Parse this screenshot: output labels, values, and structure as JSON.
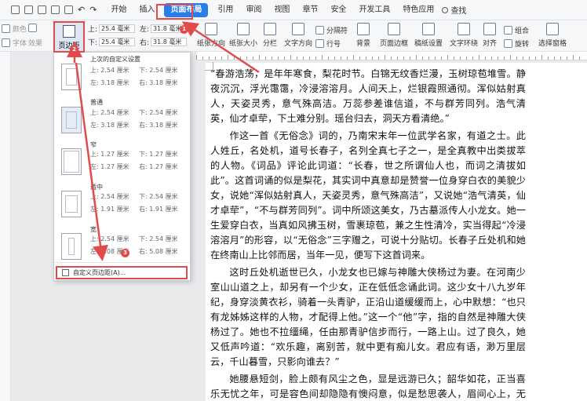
{
  "menu": {
    "tabs": [
      "开始",
      "插入",
      "页面布局",
      "引用",
      "审阅",
      "视图",
      "章节",
      "安全",
      "开发工具",
      "特色应用"
    ],
    "active_tab": "页面布局",
    "search_label": "查找"
  },
  "ribbon": {
    "theme_items": [
      "颜色",
      "字体",
      "效果"
    ],
    "margins_label": "页边距",
    "top_margin": "25.4 毫米",
    "bottom_margin": "25.4 毫米",
    "left_margin": "31.8 毫米",
    "right_margin": "31.8 毫米",
    "orientation": "纸张方向",
    "size": "纸张大小",
    "columns": "分栏",
    "text_direction": "文字方向",
    "separator": "分隔符",
    "line_numbers": "行号",
    "background": "背景",
    "page_border": "页面边框",
    "draft_settings": "稿纸设置",
    "text_wrap": "文字环绕",
    "align": "对齐",
    "rotate": "旋转",
    "group": "组合",
    "select_pane": "选择窗格",
    "up_label": "上:",
    "down_label": "下:",
    "left_label": "左:",
    "right_label": "右:"
  },
  "dropdown": {
    "items": [
      {
        "title": "上次的自定义设置",
        "top": "上: 2.54 厘米",
        "bottom": "下: 2.54 厘米",
        "left": "左: 3.18 厘米",
        "right": "右: 3.18 厘米"
      },
      {
        "title": "普通",
        "top": "上: 2.54 厘米",
        "bottom": "下: 2.54 厘米",
        "left": "左: 3.18 厘米",
        "right": "右: 3.18 厘米"
      },
      {
        "title": "窄",
        "top": "上: 1.27 厘米",
        "bottom": "下: 1.27 厘米",
        "left": "左: 1.27 厘米",
        "right": "右: 1.27 厘米"
      },
      {
        "title": "适中",
        "top": "上: 2.54 厘米",
        "bottom": "下: 2.54 厘米",
        "left": "左: 1.91 厘米",
        "right": "右: 1.91 厘米"
      },
      {
        "title": "宽",
        "top": "上: 2.54 厘米",
        "bottom": "下: 2.54 厘米",
        "left": "左: 5.08 厘米",
        "right": "右: 5.08 厘米"
      }
    ],
    "custom_label": "自定义页边距(A)..."
  },
  "badges": [
    "1",
    "2",
    "3"
  ],
  "doc": {
    "paragraphs": [
      "“春游浩荡，是年年寒食，梨花时节。白锦无纹香烂漫，玉树琼苞堆雪。静夜沉沉，浮光霭霭，冷浸溶溶月。人间天上，烂银霞照通彻。浑似姑射真人，天姿灵秀，意气殊高洁。万蕊参差谁信道，不与群芳同列。浩气清英，仙才卓荦，下土难分别。瑶台归去，洞天方看清绝。”",
      "作这一首《无俗念》词的，乃南宋末年一位武学名家，有道之士。此人姓丘，名处机，道号长春子，名列全真七子之一，是全真教中出类拔萃的人物。《词品》评论此词道：“长春，世之所谓仙人也，而词之清拔如此”。这首词诵的似是梨花，其实词中真意却是赞誉一位身穿白衣的美貌少女，说她“浑似姑射真人，天姿灵秀，意气殊高洁”，又说她“浩气清英，仙才卓荦”，“不与群芳同列”。词中所颂这美女，乃古墓派传人小龙女。她一生爱穿白衣，当真如风拂玉树，雪裹琼苞，兼之生性清冷，实当得起“冷浸溶溶月”的形容，以“无俗念”三字赠之，可说十分贴切。长春子丘处机和她在终南山上比邻而居，当年一见，便写下这首词来。",
      "这时丘处机逝世已久，小龙女也已嫁与神雕大侠杨过为妻。在河南少室山山道之上，却另有一个少女，正在低低念诵此词。这少女十八九岁年纪，身穿淡黄衣衫，骑着一头青驴，正沿山道缓缓而上，心中默想：“也只有龙姊姊这样的人物，才配得上他。”这一个“他”字，指的自然是神雕大侠杨过了。她也不拉缰绳，任由那青驴信步而行，一路上山。过了良久，她又低声吟道：“欢乐趣，离别苦，就中更有痴儿女。君应有语，渺万里层云，千山暮雪，只影向谁去？”",
      "她腰悬短剑，脸上颇有风尘之色，显是远游已久；韶华如花，正当喜乐无忧之年，可是容色间却隐隐有懊闷意，似是愁思袭人，眉间心上，无计回避。"
    ]
  }
}
